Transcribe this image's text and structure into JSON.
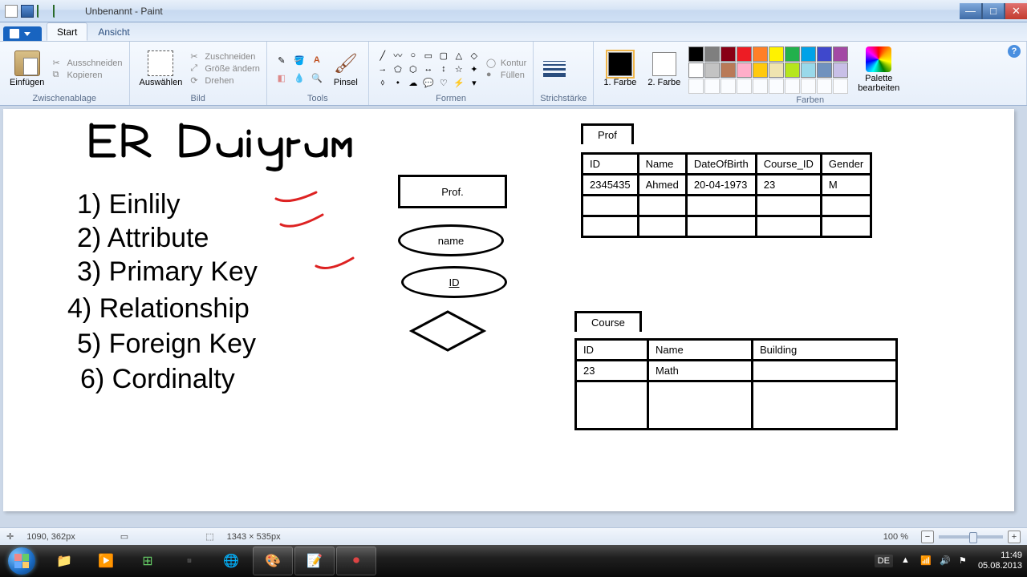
{
  "window": {
    "title": "Unbenannt - Paint"
  },
  "ribbon": {
    "tabs": {
      "start": "Start",
      "ansicht": "Ansicht"
    },
    "groups": {
      "zwischenablage": {
        "label": "Zwischenablage",
        "einfuegen": "Einfügen",
        "ausschneiden": "Ausschneiden",
        "kopieren": "Kopieren"
      },
      "bild": {
        "label": "Bild",
        "auswaehlen": "Auswählen",
        "zuschneiden": "Zuschneiden",
        "groesse": "Größe ändern",
        "drehen": "Drehen"
      },
      "tools": {
        "label": "Tools",
        "pinsel": "Pinsel"
      },
      "formen": {
        "label": "Formen",
        "kontur": "Kontur",
        "fuellen": "Füllen"
      },
      "strichstaerke": {
        "label": "Strichstärke"
      },
      "farben": {
        "label": "Farben",
        "farbe1": "1. Farbe",
        "farbe2": "2. Farbe",
        "palette": "Palette bearbeiten"
      }
    }
  },
  "canvas": {
    "title": "ER Daigram",
    "list": [
      "1) Einlily",
      "2) Attribute",
      "3) Primary Key",
      "4) Relationship",
      "5) Foreign Key",
      "6) Cordinalty"
    ],
    "shapes": {
      "rect": "Prof.",
      "ellipse1": "name",
      "ellipse2": "ID"
    },
    "prof_table": {
      "caption": "Prof",
      "headers": [
        "ID",
        "Name",
        "DateOfBirth",
        "Course_ID",
        "Gender"
      ],
      "row1": [
        "2345435",
        "Ahmed",
        "20-04-1973",
        "23",
        "M"
      ]
    },
    "course_table": {
      "caption": "Course",
      "headers": [
        "ID",
        "Name",
        "Building"
      ],
      "row1": [
        "23",
        "Math",
        ""
      ]
    }
  },
  "palette": {
    "row1": [
      "#000000",
      "#7f7f7f",
      "#880015",
      "#ed1c24",
      "#ff7f27",
      "#fff200",
      "#22b14c",
      "#00a2e8",
      "#3f48cc",
      "#a349a4"
    ],
    "row2": [
      "#ffffff",
      "#c3c3c3",
      "#b97a57",
      "#ffaec9",
      "#ffc90e",
      "#efe4b0",
      "#b5e61d",
      "#99d9ea",
      "#7092be",
      "#c8bfe7"
    ]
  },
  "status": {
    "coords": "1090, 362px",
    "size": "1343 × 535px",
    "zoom": "100 %"
  },
  "taskbar": {
    "lang": "DE",
    "time": "11:49",
    "date": "05.08.2013"
  }
}
